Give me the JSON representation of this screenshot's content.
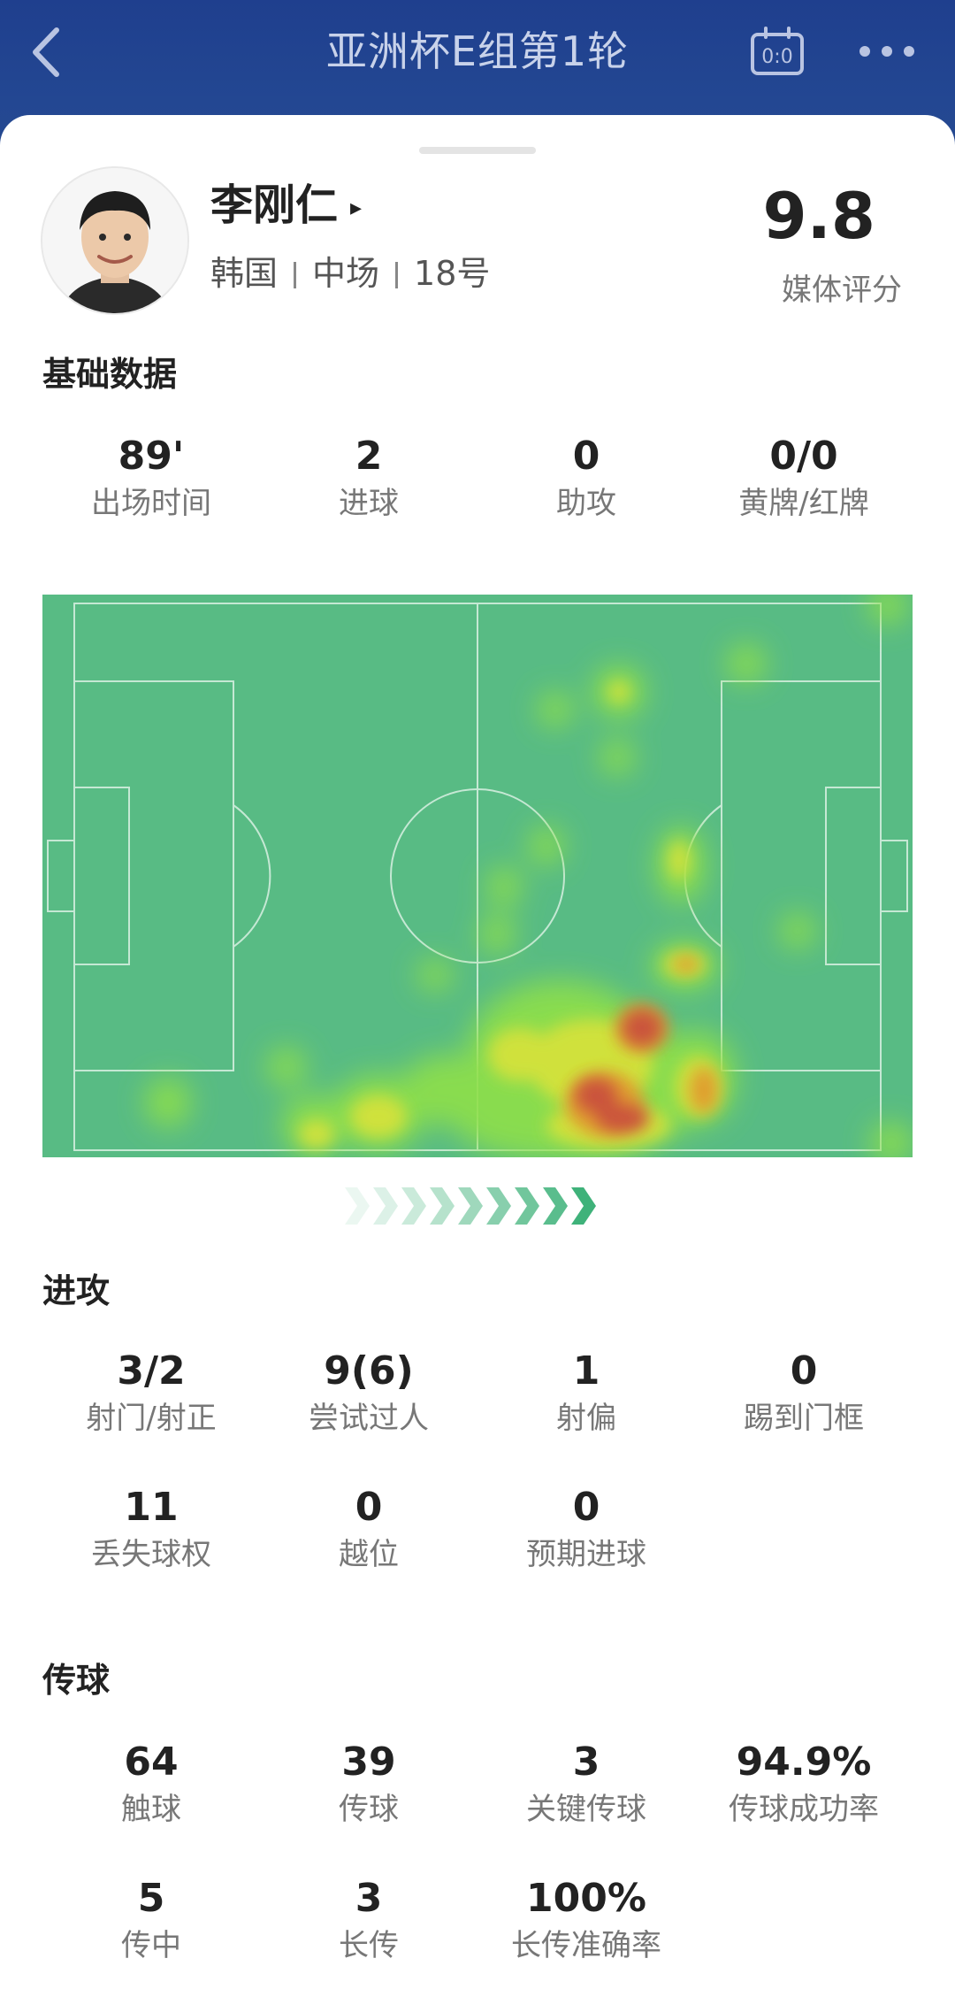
{
  "header": {
    "title": "亚洲杯E组第1轮",
    "score_icon_text": "0:0",
    "back_icon": "chevron-left-icon",
    "more_icon": "more-dots-icon",
    "bg_color": "#234792"
  },
  "player": {
    "name": "李刚仁",
    "name_arrow": "▸",
    "country": "韩国",
    "position": "中场",
    "number": "18号",
    "rating": "9.8",
    "rating_label": "媒体评分"
  },
  "basic": {
    "title": "基础数据",
    "items": [
      {
        "value": "89'",
        "label": "出场时间"
      },
      {
        "value": "2",
        "label": "进球"
      },
      {
        "value": "0",
        "label": "助攻"
      },
      {
        "value": "0/0",
        "label": "黄牌/红牌"
      }
    ]
  },
  "heatmap": {
    "pitch_color": "#58bb84",
    "direction_icon": "attack-direction-arrows-icon"
  },
  "attack": {
    "title": "进攻",
    "items": [
      {
        "value": "3/2",
        "label": "射门/射正"
      },
      {
        "value": "9(6)",
        "label": "尝试过人"
      },
      {
        "value": "1",
        "label": "射偏"
      },
      {
        "value": "0",
        "label": "踢到门框"
      },
      {
        "value": "11",
        "label": "丢失球权"
      },
      {
        "value": "0",
        "label": "越位"
      },
      {
        "value": "0",
        "label": "预期进球"
      }
    ]
  },
  "passing": {
    "title": "传球",
    "items": [
      {
        "value": "64",
        "label": "触球"
      },
      {
        "value": "39",
        "label": "传球"
      },
      {
        "value": "3",
        "label": "关键传球"
      },
      {
        "value": "94.9%",
        "label": "传球成功率"
      },
      {
        "value": "5",
        "label": "传中"
      },
      {
        "value": "3",
        "label": "长传"
      },
      {
        "value": "100%",
        "label": "长传准确率"
      }
    ]
  }
}
